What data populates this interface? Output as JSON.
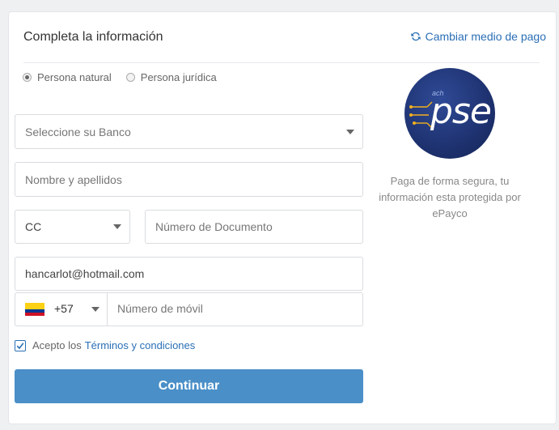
{
  "header": {
    "title": "Completa la información",
    "change_payment": "Cambiar medio de pago"
  },
  "person_type": {
    "options": [
      "Persona natural",
      "Persona jurídica"
    ],
    "selected": "Persona natural"
  },
  "bank_select": {
    "placeholder": "Seleccione su Banco"
  },
  "name_field": {
    "placeholder": "Nombre y apellidos"
  },
  "doc_type": {
    "value": "CC"
  },
  "doc_number": {
    "placeholder": "Número de Documento"
  },
  "email_field": {
    "value": "hancarlot@hotmail.com"
  },
  "phone": {
    "country_code": "+57",
    "placeholder": "Número de móvil"
  },
  "terms": {
    "prefix": "Acepto los",
    "link": "Términos y condiciones",
    "checked": true
  },
  "continue_label": "Continuar",
  "logo": {
    "ach": "ach",
    "pse": "pse"
  },
  "secure_note": "Paga de forma segura, tu información esta protegida por ePayco",
  "colors": {
    "accent": "#2a6fb6",
    "button": "#4a8fc8",
    "logo_bg": "#1e3270"
  },
  "icons": [
    "refresh-icon",
    "chevron-down-icon",
    "check-icon",
    "colombia-flag-icon"
  ]
}
